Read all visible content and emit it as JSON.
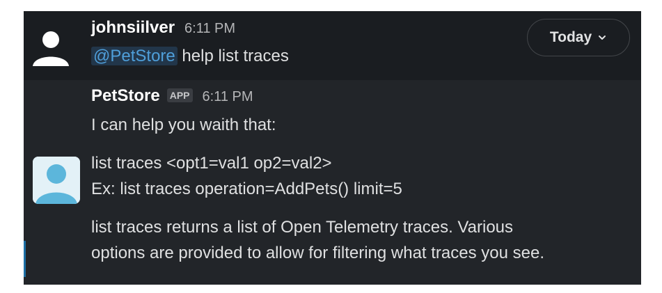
{
  "date_divider": {
    "label": "Today",
    "icon": "chevron-down-icon"
  },
  "messages": [
    {
      "sender": "johnsiilver",
      "time": "6:11 PM",
      "avatar_icon": "default-user-avatar-icon",
      "mention": "@PetStore",
      "text": "help list traces"
    },
    {
      "sender": "PetStore",
      "badge": "APP",
      "time": "6:11 PM",
      "avatar_icon": "bot-avatar-icon",
      "lines": [
        "I can help you waith that:",
        "list traces <opt1=val1 op2=val2>",
        "Ex: list traces operation=AddPets() limit=5",
        "list traces returns a list of Open Telemetry traces. Various",
        "options are provided to allow for filtering what traces you see."
      ]
    }
  ],
  "colors": {
    "background": "#1a1d21",
    "hover_background": "#222529",
    "mention_text": "#4f9fda",
    "mention_background": "#22364a",
    "avatar_blue": "#5cb6db"
  }
}
